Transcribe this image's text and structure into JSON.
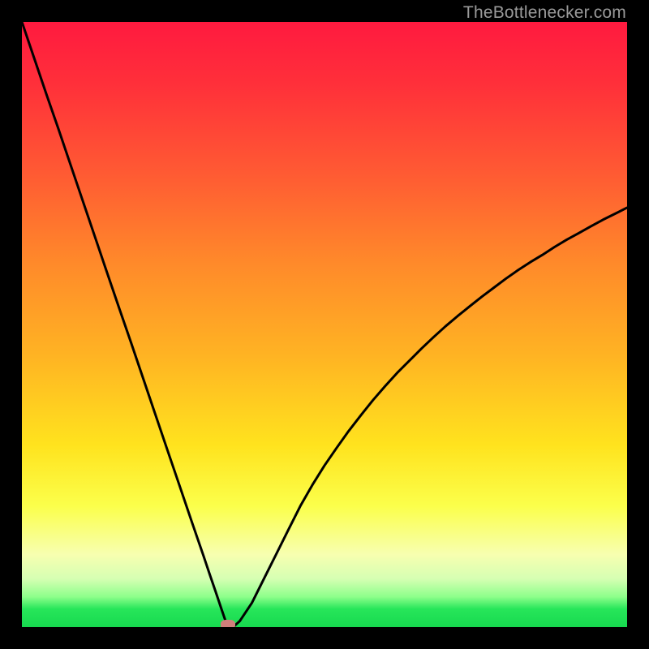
{
  "watermark": {
    "text": "TheBottlenecker.com"
  },
  "chart_data": {
    "type": "line",
    "title": "",
    "xlabel": "",
    "ylabel": "",
    "xlim": [
      0,
      100
    ],
    "ylim": [
      0,
      100
    ],
    "x": [
      0,
      2,
      4,
      6,
      8,
      10,
      12,
      14,
      16,
      18,
      20,
      22,
      24,
      26,
      28,
      30,
      31,
      32,
      33,
      34,
      35,
      36,
      38,
      40,
      42,
      44,
      46,
      48,
      50,
      52,
      54,
      56,
      58,
      60,
      62,
      64,
      66,
      68,
      70,
      72,
      74,
      76,
      78,
      80,
      82,
      84,
      86,
      88,
      90,
      92,
      94,
      96,
      98,
      100
    ],
    "y": [
      100,
      94.1,
      88.2,
      82.4,
      76.5,
      70.6,
      64.7,
      58.8,
      52.9,
      47.1,
      41.2,
      35.3,
      29.4,
      23.5,
      17.6,
      11.8,
      8.8,
      5.9,
      2.9,
      0,
      0.1,
      1,
      4,
      8,
      12,
      16,
      20,
      23.5,
      26.7,
      29.6,
      32.4,
      35,
      37.5,
      39.8,
      42,
      44,
      46,
      47.9,
      49.7,
      51.4,
      53,
      54.6,
      56.1,
      57.6,
      59,
      60.3,
      61.5,
      62.8,
      64,
      65.1,
      66.2,
      67.3,
      68.3,
      69.3
    ],
    "min_point": {
      "x": 34,
      "y": 0
    },
    "background_gradient": {
      "stops": [
        {
          "pos": 0,
          "color": "#ff1a3f"
        },
        {
          "pos": 10,
          "color": "#ff2f3a"
        },
        {
          "pos": 25,
          "color": "#ff5a33"
        },
        {
          "pos": 40,
          "color": "#ff8a2a"
        },
        {
          "pos": 55,
          "color": "#ffb323"
        },
        {
          "pos": 70,
          "color": "#ffe31e"
        },
        {
          "pos": 80,
          "color": "#fbff4b"
        },
        {
          "pos": 88,
          "color": "#f7ffb0"
        },
        {
          "pos": 92,
          "color": "#d6ffb3"
        },
        {
          "pos": 95,
          "color": "#8dff8b"
        },
        {
          "pos": 97,
          "color": "#27e65a"
        },
        {
          "pos": 100,
          "color": "#17d94f"
        }
      ]
    }
  }
}
